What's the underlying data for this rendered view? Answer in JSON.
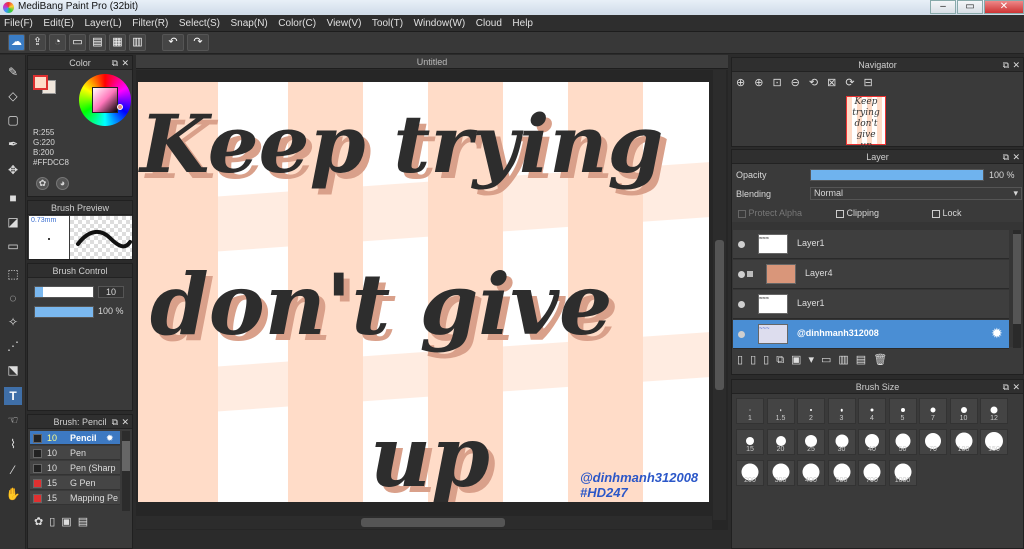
{
  "app": {
    "title": "MediBang Paint Pro (32bit)",
    "window_controls": [
      "–",
      "▭",
      "✕"
    ]
  },
  "menu": [
    "File(F)",
    "Edit(E)",
    "Layer(L)",
    "Filter(R)",
    "Select(S)",
    "Snap(N)",
    "Color(C)",
    "View(V)",
    "Tool(T)",
    "Window(W)",
    "Cloud",
    "Help"
  ],
  "toolbar_icons": [
    "cloud-icon",
    "share-icon",
    "comment-icon",
    "chat-icon",
    "page-icon",
    "pages-icon",
    "grid-icon",
    "undo-icon",
    "redo-icon"
  ],
  "tools": [
    "brush-icon",
    "eraser-icon",
    "select-rect-icon",
    "pen-icon",
    "move-icon",
    "fill-rect-icon",
    "bucket-icon",
    "gradient-icon",
    "marquee-icon",
    "lasso-icon",
    "magic-wand-icon",
    "select-pen-icon",
    "select-eraser-icon",
    "text-icon",
    "hand-pointer-icon",
    "eyedropper-icon",
    "dropper-icon",
    "hand-icon"
  ],
  "color_panel": {
    "title": "Color",
    "r": "R:255",
    "g": "G:220",
    "b": "B:200",
    "hex": "#FFDCC8",
    "foreground": "#FFDCC8",
    "background": "#f0e6dc"
  },
  "brush_preview": {
    "title": "Brush Preview",
    "size": "0.73mm"
  },
  "brush_control": {
    "title": "Brush Control",
    "size_value": "10",
    "size_fill": 0.95,
    "opacity_value": "100 %",
    "opacity_fill": 1.0
  },
  "brush_list": {
    "title": "Brush: Pencil",
    "items": [
      {
        "size": "10",
        "name": "Pencil",
        "color": "#222222",
        "active": true
      },
      {
        "size": "10",
        "name": "Pen",
        "color": "#222222",
        "active": false
      },
      {
        "size": "10",
        "name": "Pen (Sharp",
        "color": "#222222",
        "active": false
      },
      {
        "size": "15",
        "name": "G Pen",
        "color": "#e03030",
        "active": false
      },
      {
        "size": "15",
        "name": "Mapping Pe",
        "color": "#e03030",
        "active": false
      }
    ]
  },
  "document": {
    "tab_title": "Untitled",
    "stripe_color": "#FFDCC8",
    "lines": [
      "Keep trying",
      "don't give",
      "up"
    ],
    "watermark": [
      "@dinhmanh312008",
      "#HD247"
    ]
  },
  "navigator": {
    "title": "Navigator"
  },
  "layer_panel": {
    "title": "Layer",
    "opacity_label": "Opacity",
    "opacity_value": "100 %",
    "opacity_fill": 1.0,
    "blending_label": "Blending",
    "blending_value": "Normal",
    "protect_alpha": "Protect Alpha",
    "clipping": "Clipping",
    "lock": "Lock",
    "layers": [
      {
        "name": "Layer1",
        "selected": false,
        "thumb": "text"
      },
      {
        "name": "Layer4",
        "selected": false,
        "thumb": "peach"
      },
      {
        "name": "Layer1",
        "selected": false,
        "thumb": "text"
      },
      {
        "name": "@dinhmanh312008",
        "selected": true,
        "thumb": "signature"
      }
    ]
  },
  "brush_size": {
    "title": "Brush Size",
    "sizes": [
      "1",
      "1.5",
      "2",
      "3",
      "4",
      "5",
      "7",
      "10",
      "12",
      "15",
      "20",
      "25",
      "30",
      "40",
      "50",
      "70",
      "100",
      "150",
      "200",
      "300",
      "400",
      "500",
      "700",
      "1000"
    ]
  }
}
